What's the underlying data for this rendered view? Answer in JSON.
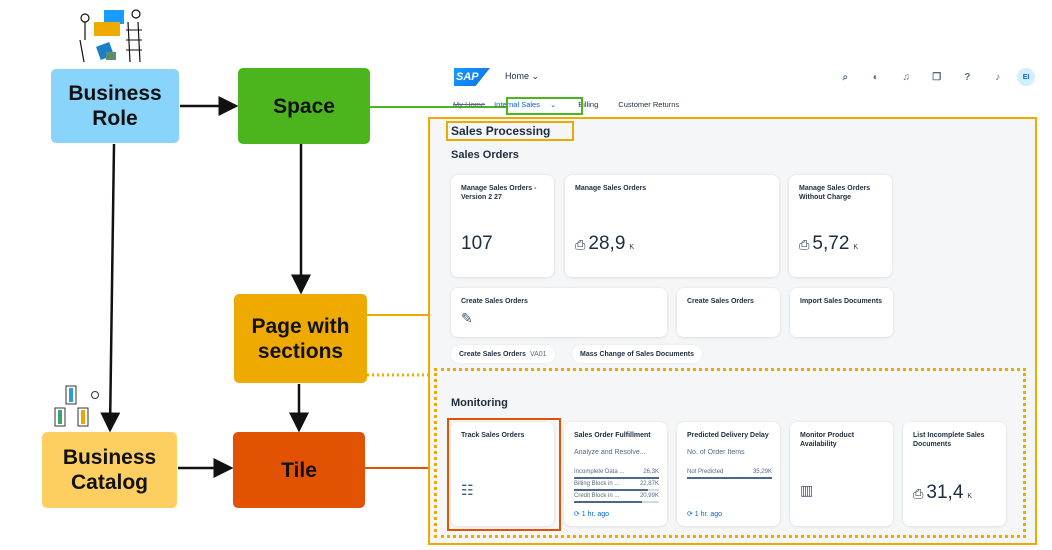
{
  "diagram": {
    "boxes": {
      "business_role": "Business Role",
      "space": "Space",
      "page_with_sections": "Page with sections",
      "business_catalog": "Business Catalog",
      "tile": "Tile"
    },
    "colors": {
      "business_role": "#89d4fb",
      "space": "#4cb51e",
      "page": "#eeaa00",
      "catalog": "#fdcf61",
      "tile": "#e25203"
    }
  },
  "shell": {
    "logo": "SAP",
    "home_menu": "Home ⌄",
    "icons": [
      "search-icon",
      "copilot-icon",
      "headset-icon",
      "notes-icon",
      "help-icon",
      "bell-icon"
    ],
    "icon_glyphs": [
      "⌕",
      "◐",
      "♫",
      "❐",
      "?",
      "♪"
    ],
    "avatar_initials": "EI"
  },
  "tabs": {
    "my_home": "My Home",
    "internal_sales": "Internal Sales",
    "chevron": "⌄",
    "billing": "Billing",
    "customer_returns": "Customer Returns"
  },
  "page": {
    "section_title": "Sales Processing",
    "groups": {
      "sales_orders": "Sales Orders",
      "monitoring": "Monitoring"
    },
    "tiles": {
      "manage_v2": {
        "title": "Manage Sales Orders - Version 2 27",
        "value": "107"
      },
      "manage": {
        "title": "Manage Sales Orders",
        "value": "28,9",
        "unit": "K"
      },
      "manage_wo_charge": {
        "title": "Manage Sales Orders Without Charge",
        "value": "5,72",
        "unit": "K"
      },
      "create_1": {
        "title": "Create Sales Orders"
      },
      "create_2": {
        "title": "Create Sales Orders"
      },
      "import": {
        "title": "Import Sales Documents"
      },
      "track": {
        "title": "Track Sales Orders"
      },
      "fulfillment": {
        "title": "Sales Order Fulfillment",
        "subtitle": "Analyze and Resolve...",
        "bars": [
          {
            "label": "Incomplete Data ...",
            "value": "26,3K",
            "fraction": 1.0
          },
          {
            "label": "Billing Block in ...",
            "value": "22,87K",
            "fraction": 0.87
          },
          {
            "label": "Credit Block in ...",
            "value": "20,99K",
            "fraction": 0.8
          }
        ],
        "refresh": "⟳ 1 hr. ago"
      },
      "predicted_delay": {
        "title": "Predicted Delivery Delay",
        "subtitle": "No. of Order Items",
        "bars": [
          {
            "label": "Not Predicted",
            "value": "35,29K",
            "fraction": 1.0
          }
        ],
        "refresh": "⟳ 1 hr. ago"
      },
      "monitor_availability": {
        "title": "Monitor Product Availability"
      },
      "list_incomplete": {
        "title": "List Incomplete Sales Documents",
        "value": "31,4",
        "unit": "K"
      }
    },
    "links": {
      "create_va01": {
        "title": "Create Sales Orders",
        "sub": "VA01"
      },
      "mass_change": {
        "title": "Mass Change of Sales Documents"
      }
    }
  }
}
